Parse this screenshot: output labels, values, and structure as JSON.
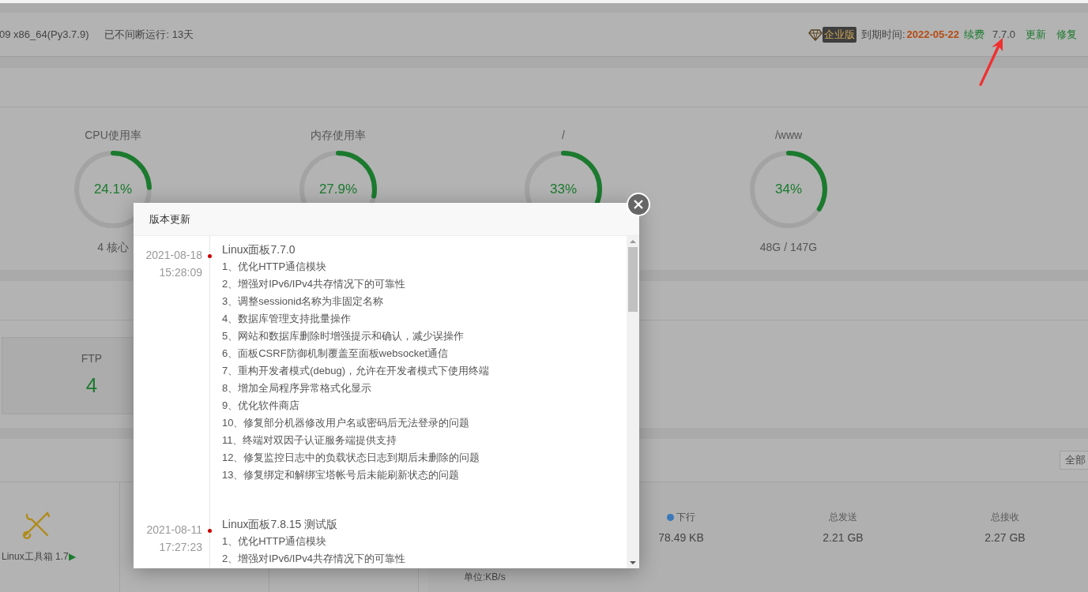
{
  "header": {
    "system_info": "09 x86_64(Py3.7.9)",
    "uptime": "已不间断运行: 13天",
    "edition_badge": "企业版",
    "expiry_label": "到期时间:",
    "expiry_date": "2022-05-22",
    "renew_link": "续费",
    "version": "7.7.0",
    "update_link": "更新",
    "repair_link": "修复"
  },
  "gauges": [
    {
      "label": "CPU使用率",
      "value_text": "24.1%",
      "level": 0.241,
      "footer": "4 核心"
    },
    {
      "label": "内存使用率",
      "value_text": "27.9%",
      "level": 0.279
    },
    {
      "label": "/",
      "value_text": "33%",
      "level": 0.33
    },
    {
      "label": "/www",
      "value_text": "34%",
      "level": 0.34,
      "footer": "48G / 147G"
    }
  ],
  "overview": {
    "cards": [
      {
        "label": "FTP",
        "value": "4"
      }
    ]
  },
  "software": {
    "filter_button": "全部",
    "items": [
      {
        "name": "Linux工具箱 1.7",
        "play": "▶"
      }
    ]
  },
  "network": {
    "stats": [
      {
        "kind": "legend",
        "label": "下行",
        "value": "78.49 KB",
        "color": "#3a78b8"
      },
      {
        "kind": "total",
        "label": "总发送",
        "value": "2.21 GB"
      },
      {
        "kind": "total",
        "label": "总接收",
        "value": "2.27 GB"
      }
    ],
    "unit": "单位:KB/s"
  },
  "dialog": {
    "title": "版本更新",
    "entries": [
      {
        "date": "2021-08-18",
        "time": "15:28:09",
        "title": "Linux面板7.7.0",
        "lines": [
          "1、优化HTTP通信模块",
          "2、增强对IPv6/IPv4共存情况下的可靠性",
          "3、调整sessionid名称为非固定名称",
          "4、数据库管理支持批量操作",
          "5、网站和数据库删除时增强提示和确认，减少误操作",
          "6、面板CSRF防御机制覆盖至面板websocket通信",
          "7、重构开发者模式(debug)，允许在开发者模式下使用终端",
          "8、增加全局程序异常格式化显示",
          "9、优化软件商店",
          "10、修复部分机器修改用户名或密码后无法登录的问题",
          "11、终端对双因子认证服务端提供支持",
          "12、修复监控日志中的负载状态日志到期后未删除的问题",
          "13、修复绑定和解绑宝塔帐号后未能刷新状态的问题"
        ]
      },
      {
        "date": "2021-08-11",
        "time": "17:27:23",
        "title": "Linux面板7.8.15 测试版",
        "lines": [
          "1、优化HTTP通信模块",
          "2、增强对IPv6/IPv4共存情况下的可靠性"
        ]
      }
    ]
  }
}
